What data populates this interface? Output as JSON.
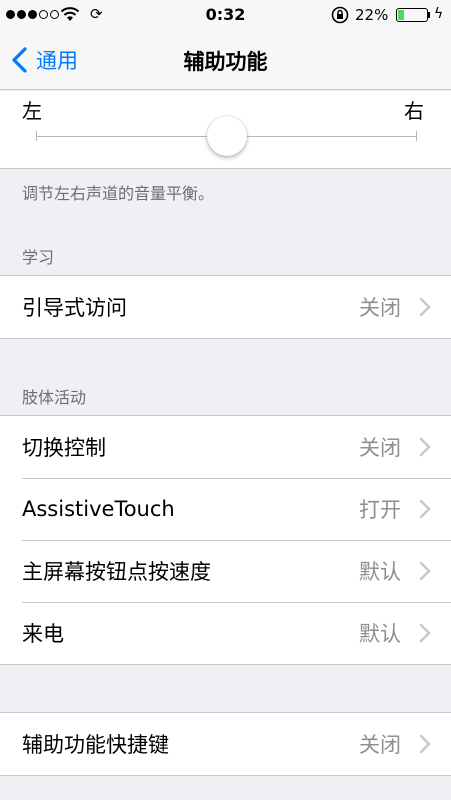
{
  "status_bar": {
    "signal_dots_filled": 3,
    "signal_dots_total": 5,
    "time": "0:32",
    "battery_percent": "22%",
    "battery_level": 0.22,
    "battery_color": "#4cd964"
  },
  "nav": {
    "back_label": "通用",
    "title": "辅助功能",
    "accent_color": "#007aff"
  },
  "balance": {
    "left_label": "左",
    "right_label": "右",
    "value": 0.5,
    "footer": "调节左右声道的音量平衡。"
  },
  "sections": {
    "learning": {
      "header": "学习",
      "rows": [
        {
          "label": "引导式访问",
          "value": "关闭"
        }
      ]
    },
    "motor": {
      "header": "肢体活动",
      "rows": [
        {
          "label": "切换控制",
          "value": "关闭"
        },
        {
          "label": "AssistiveTouch",
          "value": "打开"
        },
        {
          "label": "主屏幕按钮点按速度",
          "value": "默认"
        },
        {
          "label": "来电",
          "value": "默认"
        }
      ]
    },
    "shortcut": {
      "rows": [
        {
          "label": "辅助功能快捷键",
          "value": "关闭"
        }
      ]
    }
  },
  "icons": [
    "wifi-icon",
    "sync-icon",
    "rotation-lock-icon",
    "battery-icon",
    "charging-icon",
    "back-chevron-icon",
    "chevron-right-icon"
  ]
}
